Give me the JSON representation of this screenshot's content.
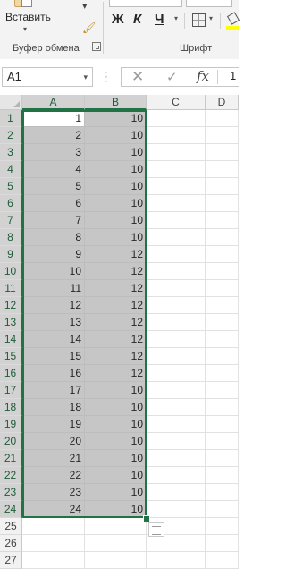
{
  "ribbon": {
    "paste_label": "Вставить",
    "clipboard_group": "Буфер обмена",
    "font_group": "Шрифт",
    "bold": "Ж",
    "italic": "К",
    "underline": "Ч",
    "colors": {
      "fill": "#ffff00",
      "accent": "#217346"
    }
  },
  "formula_bar": {
    "name_box": "A1",
    "content": "1",
    "fx": "fx"
  },
  "columns": [
    "A",
    "B",
    "C",
    "D"
  ],
  "rows": [
    {
      "n": "1",
      "a": "1",
      "b": "10"
    },
    {
      "n": "2",
      "a": "2",
      "b": "10"
    },
    {
      "n": "3",
      "a": "3",
      "b": "10"
    },
    {
      "n": "4",
      "a": "4",
      "b": "10"
    },
    {
      "n": "5",
      "a": "5",
      "b": "10"
    },
    {
      "n": "6",
      "a": "6",
      "b": "10"
    },
    {
      "n": "7",
      "a": "7",
      "b": "10"
    },
    {
      "n": "8",
      "a": "8",
      "b": "10"
    },
    {
      "n": "9",
      "a": "9",
      "b": "12"
    },
    {
      "n": "10",
      "a": "10",
      "b": "12"
    },
    {
      "n": "11",
      "a": "11",
      "b": "12"
    },
    {
      "n": "12",
      "a": "12",
      "b": "12"
    },
    {
      "n": "13",
      "a": "13",
      "b": "12"
    },
    {
      "n": "14",
      "a": "14",
      "b": "12"
    },
    {
      "n": "15",
      "a": "15",
      "b": "12"
    },
    {
      "n": "16",
      "a": "16",
      "b": "12"
    },
    {
      "n": "17",
      "a": "17",
      "b": "10"
    },
    {
      "n": "18",
      "a": "18",
      "b": "10"
    },
    {
      "n": "19",
      "a": "19",
      "b": "10"
    },
    {
      "n": "20",
      "a": "20",
      "b": "10"
    },
    {
      "n": "21",
      "a": "21",
      "b": "10"
    },
    {
      "n": "22",
      "a": "22",
      "b": "10"
    },
    {
      "n": "23",
      "a": "23",
      "b": "10"
    },
    {
      "n": "24",
      "a": "24",
      "b": "10"
    },
    {
      "n": "25",
      "a": "",
      "b": ""
    },
    {
      "n": "26",
      "a": "",
      "b": ""
    },
    {
      "n": "27",
      "a": "",
      "b": ""
    }
  ],
  "selection": "A1:B24",
  "icons": [
    "paste-icon",
    "format-painter-icon",
    "dialog-launcher-icon",
    "borders-icon",
    "fill-color-icon",
    "cancel-icon",
    "enter-icon",
    "insert-function-icon",
    "quick-analysis-icon"
  ]
}
